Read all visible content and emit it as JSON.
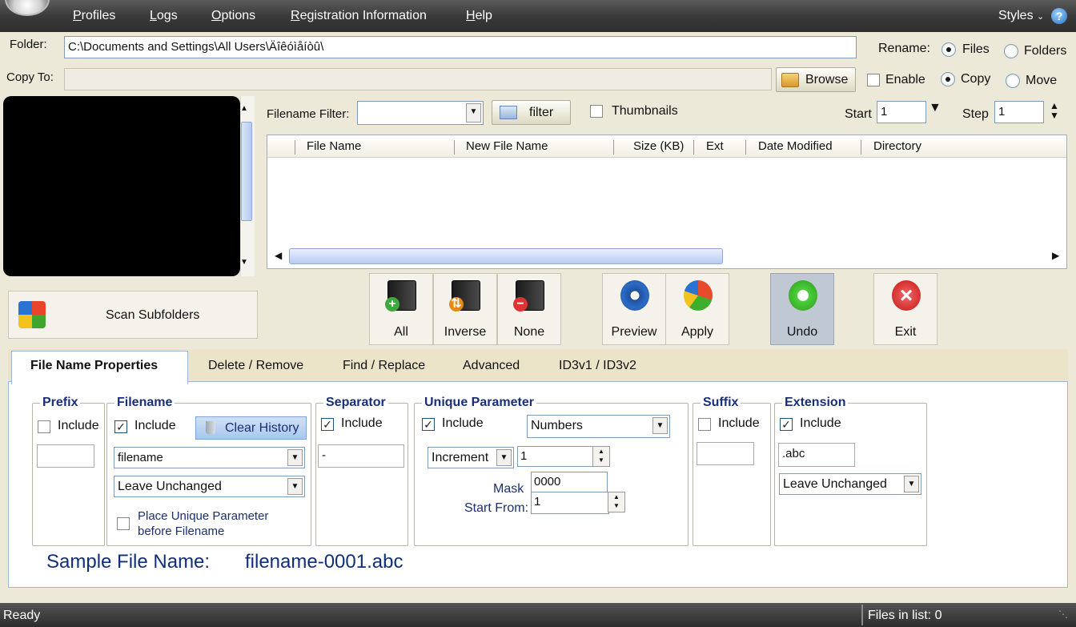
{
  "menu": {
    "items": [
      "Profiles",
      "Logs",
      "Options",
      "Registration Information",
      "Help"
    ],
    "styles_label": "Styles",
    "help_icon": "?"
  },
  "folder": {
    "label": "Folder:",
    "path": "C:\\Documents and Settings\\All Users\\Äîêóìåíòû\\"
  },
  "copy_to": {
    "label": "Copy To:",
    "value": "",
    "browse_label": "Browse",
    "enable_label": "Enable",
    "copy_label": "Copy",
    "move_label": "Move"
  },
  "rename": {
    "label": "Rename:",
    "files_label": "Files",
    "folders_label": "Folders"
  },
  "filter": {
    "label": "Filename Filter:",
    "value": "",
    "button_label": "filter",
    "thumbnails_label": "Thumbnails",
    "start_label": "Start",
    "start_value": "1",
    "step_label": "Step",
    "step_value": "1"
  },
  "file_table": {
    "columns": [
      "File Name",
      "New File Name",
      "Size (KB)",
      "Ext",
      "Date Modified",
      "Directory"
    ]
  },
  "actions": {
    "all": "All",
    "inverse": "Inverse",
    "none": "None",
    "preview": "Preview",
    "apply": "Apply",
    "undo": "Undo",
    "exit": "Exit",
    "scan_subfolders": "Scan Subfolders"
  },
  "tabs": [
    "File Name Properties",
    "Delete / Remove",
    "Find / Replace",
    "Advanced",
    "ID3v1 / ID3v2"
  ],
  "prefix": {
    "title": "Prefix",
    "include_label": "Include",
    "value": ""
  },
  "filename": {
    "title": "Filename",
    "include_label": "Include",
    "clear_history_label": "Clear History",
    "combo_value": "filename",
    "case_value": "Leave Unchanged",
    "place_unique_line1": "Place Unique Parameter",
    "place_unique_line2": "before Filename"
  },
  "separator": {
    "title": "Separator",
    "include_label": "Include",
    "value": "-"
  },
  "unique": {
    "title": "Unique Parameter",
    "include_label": "Include",
    "type_value": "Numbers",
    "mode_value": "Increment",
    "increment_value": "1",
    "mask_label": "Mask",
    "mask_value": "0000",
    "start_from_label": "Start From:",
    "start_from_value": "1"
  },
  "suffix": {
    "title": "Suffix",
    "include_label": "Include",
    "value": ""
  },
  "extension": {
    "title": "Extension",
    "include_label": "Include",
    "value": ".abc",
    "case_value": "Leave Unchanged"
  },
  "sample": {
    "label": "Sample File Name:",
    "value": "filename-0001.abc"
  },
  "status": {
    "text": "Ready",
    "files_in_list": "Files in list: 0"
  },
  "colors": {
    "menubar": "#3a3a3a",
    "accent_blue": "#1a2f7a",
    "panel_bg": "#ece9d8"
  }
}
